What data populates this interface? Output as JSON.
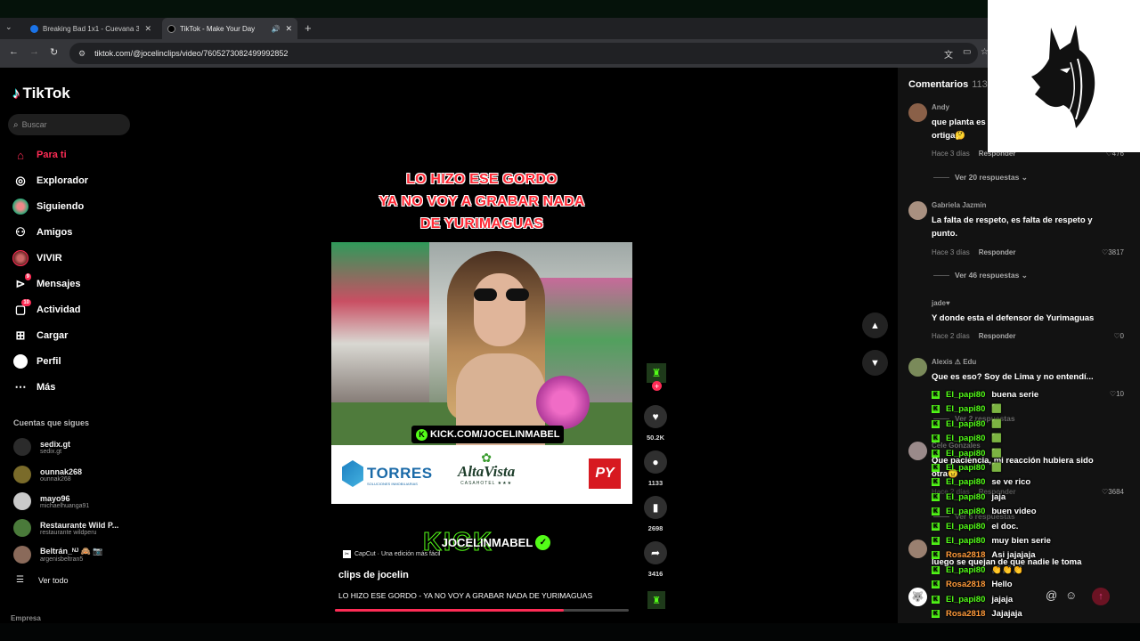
{
  "browser": {
    "tabs": [
      {
        "title": "Breaking Bad 1x1 - Cuevana 3",
        "favicon_color": "#1a73e8"
      },
      {
        "title": "TikTok - Make Your Day",
        "favicon_color": "#000000"
      }
    ],
    "url": "tiktok.com/@jocelinclips/video/7605273082499992852"
  },
  "sidebar": {
    "logo": "TikTok",
    "search_placeholder": "Buscar",
    "nav": [
      {
        "label": "Para ti",
        "icon": "home-icon",
        "active": true
      },
      {
        "label": "Explorador",
        "icon": "compass-icon"
      },
      {
        "label": "Siguiendo",
        "icon": "following-avatar-icon"
      },
      {
        "label": "Amigos",
        "icon": "friends-icon"
      },
      {
        "label": "VIVIR",
        "icon": "live-avatar-icon"
      },
      {
        "label": "Mensajes",
        "icon": "messages-icon",
        "badge": "9"
      },
      {
        "label": "Actividad",
        "icon": "activity-icon",
        "badge": "10"
      },
      {
        "label": "Cargar",
        "icon": "upload-icon"
      },
      {
        "label": "Perfil",
        "icon": "profile-icon"
      },
      {
        "label": "Más",
        "icon": "more-icon"
      }
    ],
    "following_title": "Cuentas que sigues",
    "following": [
      {
        "name": "sedix.gt",
        "handle": "sedix.gt",
        "color": "#2b2b2b"
      },
      {
        "name": "ounnak268",
        "handle": "ounnak268",
        "color": "#7a6b2a"
      },
      {
        "name": "mayo96",
        "handle": "michaelhuanga91",
        "color": "#c9c9c9"
      },
      {
        "name": "Restaurante Wild P...",
        "handle": "restaurante wildperu",
        "color": "#4a7a3a"
      },
      {
        "name": "Beltrán_ᴺᴶ 🙈 📷",
        "handle": "argenisbeltran5",
        "color": "#8a6a5a"
      }
    ],
    "see_all": "Ver todo",
    "footer": "Empresa"
  },
  "video": {
    "caption_lines": [
      "LO HIZO ESE GORDO",
      "YA NO VOY A GRABAR NADA",
      "DE YURIMAGUAS"
    ],
    "kick_tag": "KICK.COM/JOCELINMABEL",
    "sponsors": {
      "torres": "TORRES",
      "torres_sub": "SOLUCIONES INMOBILIARIAS",
      "alta": "AltaVista",
      "alta_sub": "CASAHOTEL ★★★",
      "pv": "PY"
    },
    "kick_banner_back": "KICK",
    "kick_banner": "JOCELINMABEL",
    "capcut": "CapCut · Una edición más fácil",
    "author": "clips de jocelin",
    "description": "LO HIZO ESE GORDO - YA NO VOY A GRABAR NADA DE YURIMAGUAS",
    "progress": 0.78
  },
  "actions": {
    "likes": "50.2K",
    "comments": "1133",
    "saves": "2698",
    "shares": "3416"
  },
  "comments": {
    "title": "Comentarios",
    "count": "113",
    "items": [
      {
        "user": "Andy",
        "text": "que planta es ortiga🤔",
        "time": "Hace 3 días",
        "reply": "Responder",
        "likes": "476",
        "replies": "Ver 20 respuestas",
        "avatar_color": "#8a6048"
      },
      {
        "user": "Gabriela Jazmín",
        "text": "La falta de respeto, es falta de respeto y punto.",
        "time": "Hace 3 días",
        "reply": "Responder",
        "likes": "3817",
        "replies": "Ver 46 respuestas",
        "avatar_color": "#a89080"
      },
      {
        "user": "jade♥",
        "text": "Y donde esta el defensor de Yurimaguas",
        "time": "Hace 2 días",
        "reply": "Responder",
        "likes": "0",
        "avatar_color": "#121212"
      },
      {
        "user": "Alexis ⚠ Edu",
        "text": "Que es eso? Soy de Lima y no entendí...",
        "likes": "10",
        "replies": "Ver 2 respuestas",
        "avatar_color": "#7a8a5a"
      },
      {
        "user": "Cele Gonzales",
        "text": "Que paciencia, mi reacción hubiera sido otra😠",
        "time": "Hace 2 días",
        "reply": "Responder",
        "likes": "3684",
        "replies": "Ver 6 respuestas",
        "avatar_color": "#9a8a8a"
      },
      {
        "user": "",
        "text": "luego se quejan de que nadie le toma",
        "avatar_color": "#9a8070"
      }
    ],
    "reply_avatar": "🐺"
  },
  "chat": [
    {
      "user": "El_papi80",
      "msg": "buena serie",
      "color": "#53fc18"
    },
    {
      "user": "El_papi80",
      "msg": "🟩",
      "color": "#53fc18"
    },
    {
      "user": "El_papi80",
      "msg": "🟩",
      "color": "#53fc18"
    },
    {
      "user": "El_papi80",
      "msg": "🟩",
      "color": "#53fc18"
    },
    {
      "user": "El_papi80",
      "msg": "🟩",
      "color": "#53fc18"
    },
    {
      "user": "El_papi80",
      "msg": "🟩",
      "color": "#53fc18"
    },
    {
      "user": "El_papi80",
      "msg": "se ve rico",
      "color": "#53fc18"
    },
    {
      "user": "El_papi80",
      "msg": "jaja",
      "color": "#53fc18"
    },
    {
      "user": "El_papi80",
      "msg": "buen video",
      "color": "#53fc18"
    },
    {
      "user": "El_papi80",
      "msg": "el doc.",
      "color": "#53fc18"
    },
    {
      "user": "El_papi80",
      "msg": "muy bien serie",
      "color": "#53fc18"
    },
    {
      "user": "Rosa2818",
      "msg": "Asi jajajaja",
      "color": "#ff9a3a"
    },
    {
      "user": "El_papi80",
      "msg": "👏👏👏",
      "color": "#53fc18"
    },
    {
      "user": "Rosa2818",
      "msg": "Hello",
      "color": "#ff9a3a"
    },
    {
      "user": "El_papi80",
      "msg": "jajaja",
      "color": "#53fc18"
    },
    {
      "user": "Rosa2818",
      "msg": "Jajajaja",
      "color": "#ff9a3a"
    }
  ]
}
